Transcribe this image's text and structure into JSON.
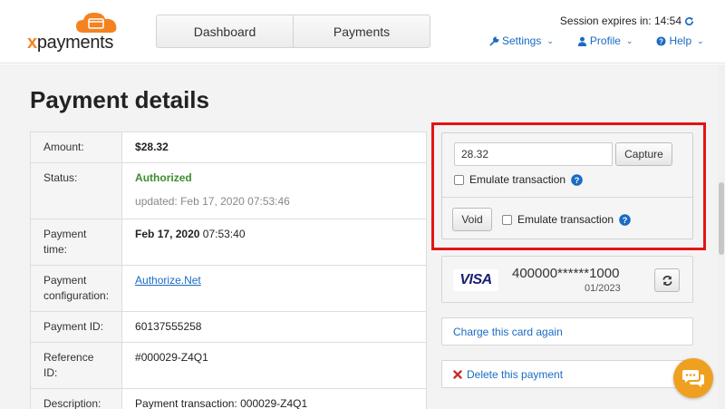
{
  "brand": {
    "name": "xpayments",
    "accent": "#f58220"
  },
  "nav": {
    "tabs": [
      {
        "label": "Dashboard"
      },
      {
        "label": "Payments"
      }
    ]
  },
  "session": {
    "text": "Session expires in: 14:54",
    "icon": "refresh-icon"
  },
  "topmenu": {
    "settings": {
      "label": "Settings",
      "icon": "wrench-icon"
    },
    "profile": {
      "label": "Profile",
      "icon": "user-icon"
    },
    "help": {
      "label": "Help",
      "icon": "question-circle-icon"
    }
  },
  "page": {
    "title": "Payment details"
  },
  "details": {
    "amount": {
      "label": "Amount:",
      "value": "$28.32"
    },
    "status": {
      "label": "Status:",
      "value": "Authorized",
      "updated": "updated: Feb 17, 2020 07:53:46"
    },
    "payment_time": {
      "label": "Payment time:",
      "date": "Feb 17, 2020",
      "time": "07:53:40"
    },
    "payment_configuration": {
      "label": "Payment configuration:",
      "value": "Authorize.Net"
    },
    "payment_id": {
      "label": "Payment ID:",
      "value": "60137555258"
    },
    "reference_id": {
      "label": "Reference ID:",
      "value": "#000029-Z4Q1"
    },
    "description": {
      "label": "Description:",
      "value": "Payment transaction: 000029-Z4Q1"
    }
  },
  "actions": {
    "capture_amount": "28.32",
    "capture_label": "Capture",
    "emulate_label": "Emulate transaction",
    "void_label": "Void",
    "highlight_color": "#e41414"
  },
  "card": {
    "brand": "VISA",
    "number": "400000******1000",
    "expiry": "01/2023"
  },
  "links": {
    "charge_again": "Charge this card again",
    "delete_payment": "Delete this payment"
  },
  "colors": {
    "link": "#1a6bc4",
    "status_green": "#3c8d2f",
    "chat": "#f0a020"
  }
}
